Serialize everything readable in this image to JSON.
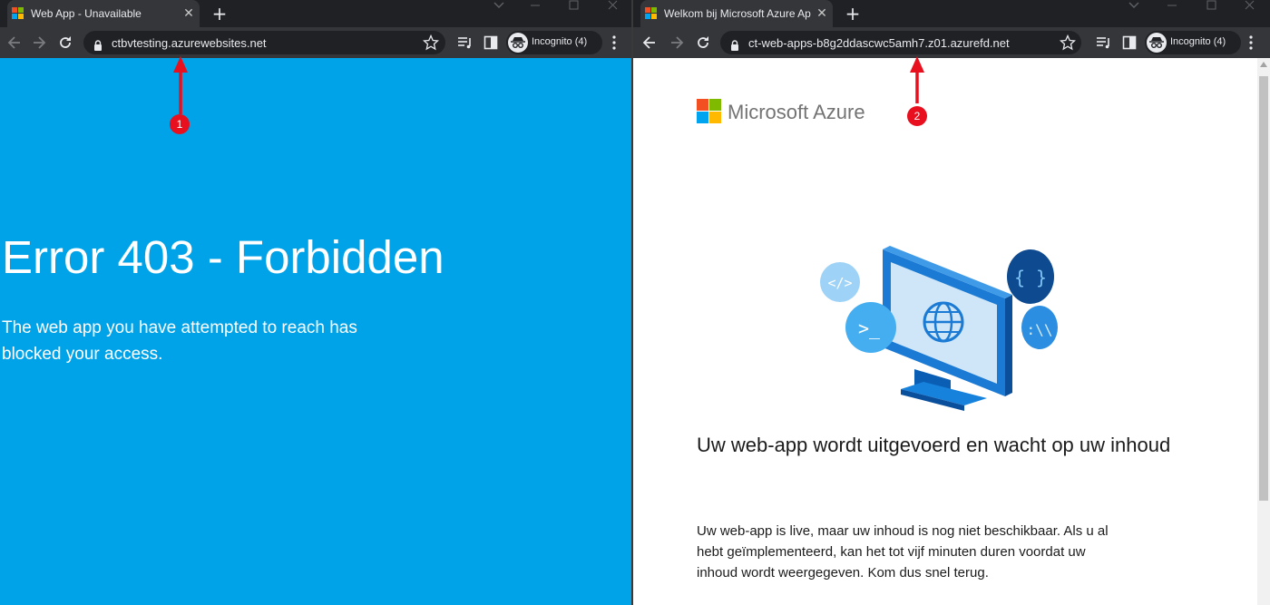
{
  "left_window": {
    "tab_title": "Web App - Unavailable",
    "url": "ctbvtesting.azurewebsites.net",
    "incognito_label": "Incognito (4)",
    "page": {
      "background_color": "#00a2e8",
      "error_title": "Error 403 - Forbidden",
      "error_message": "The web app you have attempted to reach has blocked your access."
    }
  },
  "right_window": {
    "tab_title": "Welkom bij Microsoft Azure App",
    "url": "ct-web-apps-b8g2ddascwc5amh7.z01.azurefd.net",
    "incognito_label": "Incognito (4)",
    "page": {
      "brand_name": "Microsoft Azure",
      "heading": "Uw web-app wordt uitgevoerd en wacht op uw inhoud",
      "body": "Uw web-app is live, maar uw inhoud is nog niet beschikbaar. Als u al hebt geïmplementeerd, kan het tot vijf minuten duren voordat uw inhoud wordt weergegeven. Kom dus snel terug."
    }
  },
  "annotations": [
    {
      "label": "1",
      "color": "#e8101e"
    },
    {
      "label": "2",
      "color": "#e8101e"
    }
  ],
  "icons": {
    "tab_favicon": "microsoft-logo-icon",
    "new_tab": "plus-icon",
    "close_tab": "close-icon",
    "back": "arrow-left-icon",
    "forward": "arrow-right-icon",
    "reload": "reload-icon",
    "lock": "lock-icon",
    "bookmark": "star-icon",
    "reading_list": "reading-list-icon",
    "side_panel": "side-panel-icon",
    "incognito": "incognito-icon",
    "menu": "kebab-menu-icon"
  }
}
